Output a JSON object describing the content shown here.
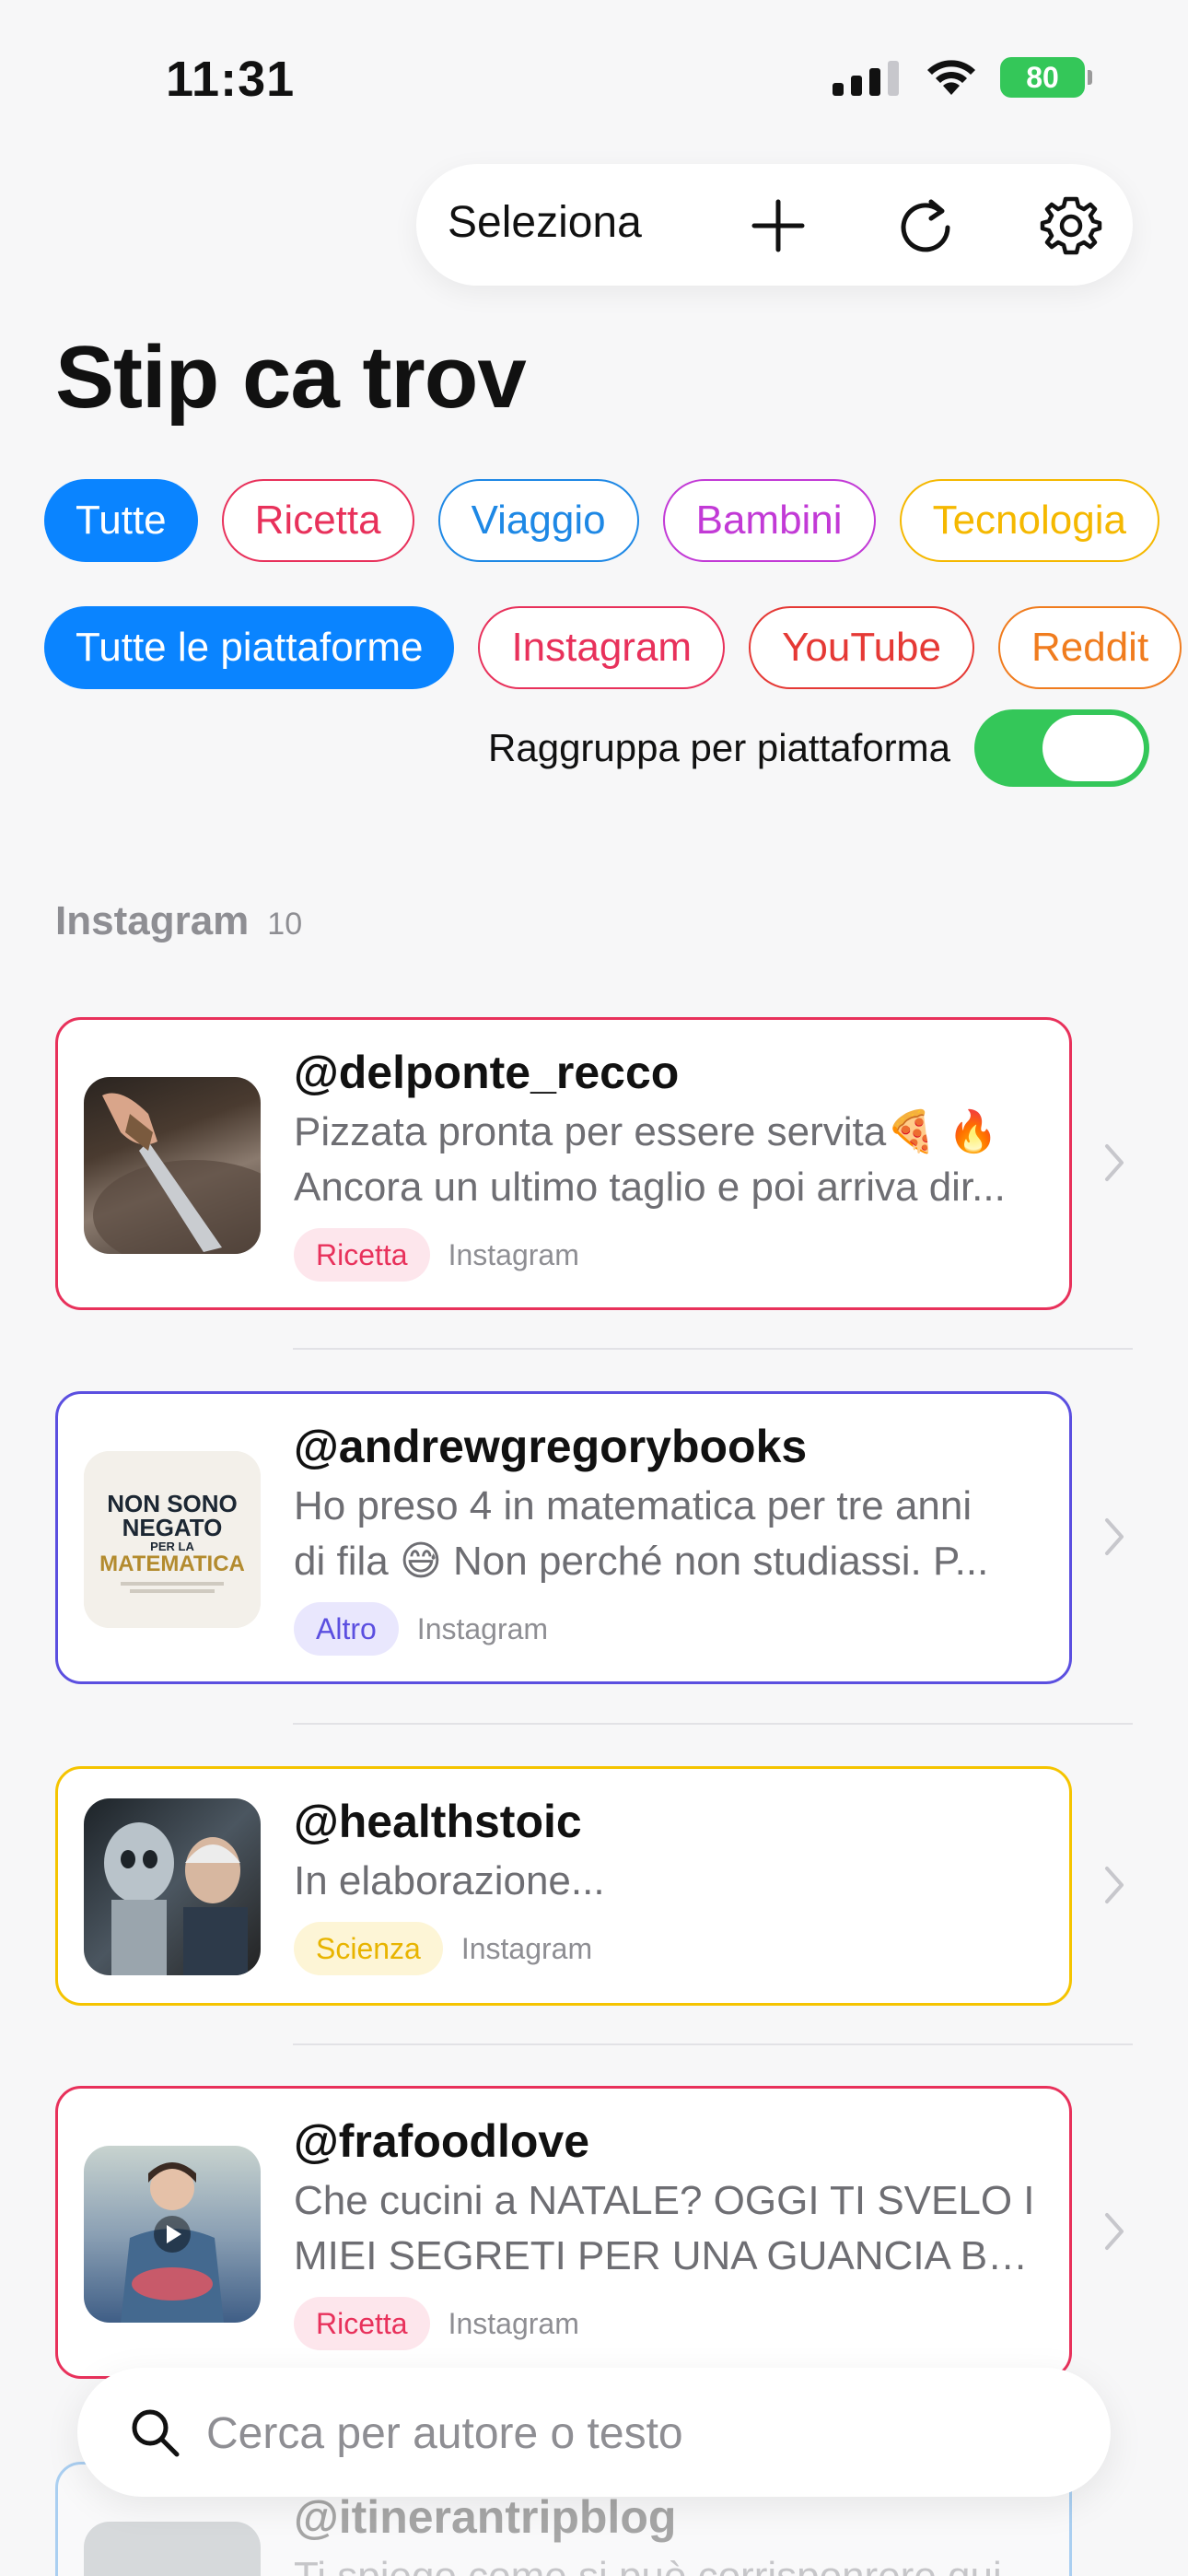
{
  "status_bar": {
    "time": "11:31",
    "battery": "80"
  },
  "toolbar": {
    "select_label": "Seleziona"
  },
  "page_title": "Stip ca trov",
  "category_filters": [
    {
      "label": "Tutte",
      "color": "#0a84ff",
      "active": true
    },
    {
      "label": "Ricetta",
      "color": "#e8315b"
    },
    {
      "label": "Viaggio",
      "color": "#1e88e5"
    },
    {
      "label": "Bambini",
      "color": "#c23ad6"
    },
    {
      "label": "Tecnologia",
      "color": "#f5b800"
    }
  ],
  "platform_filters": [
    {
      "label": "Tutte le piattaforme",
      "color": "#0a84ff",
      "active": true
    },
    {
      "label": "Instagram",
      "color": "#e8315b"
    },
    {
      "label": "YouTube",
      "color": "#e53935"
    },
    {
      "label": "Reddit",
      "color": "#f07c1e"
    }
  ],
  "group_toggle": {
    "label": "Raggruppa per piattaforma",
    "on": true
  },
  "section": {
    "title": "Instagram",
    "count": "10"
  },
  "cards": [
    {
      "handle": "@delponte_recco",
      "line1": "Pizzata pronta per essere servita🍕 🔥",
      "line2": "Ancora un ultimo taglio e poi arriva dir...",
      "tag": "Ricetta",
      "tag_color": "#e8315b",
      "tag_bg": "#fde6ec",
      "platform": "Instagram",
      "border": "#e8315b"
    },
    {
      "handle": "@andrewgregorybooks",
      "line1": "Ho preso 4 in matematica per tre anni",
      "line2": "di fila 😅 Non perché non studiassi. P...",
      "tag": "Altro",
      "tag_color": "#5b4fe0",
      "tag_bg": "#e9e7fd",
      "platform": "Instagram",
      "border": "#5b4fe0",
      "thumb_text": [
        "NON SONO",
        "NEGATO",
        "PER LA",
        "MATEMATICA"
      ]
    },
    {
      "handle": "@healthstoic",
      "line1": "In elaborazione...",
      "tag": "Scienza",
      "tag_color": "#e8b400",
      "tag_bg": "#fdf5d6",
      "platform": "Instagram",
      "border": "#f5c400"
    },
    {
      "handle": "@frafoodlove",
      "line1": "Che cucini a NATALE? OGGI TI SVELO I",
      "line2": "MIEI SEGRETI PER UNA GUANCIA BR...",
      "tag": "Ricetta",
      "tag_color": "#e8315b",
      "tag_bg": "#fde6ec",
      "platform": "Instagram",
      "border": "#e8315b"
    },
    {
      "handle": "@itinerantripblog",
      "line1": "Ti spiego come si può corrisponrere qui",
      "border": "#1e88e5"
    }
  ],
  "search": {
    "placeholder": "Cerca per autore o testo"
  }
}
